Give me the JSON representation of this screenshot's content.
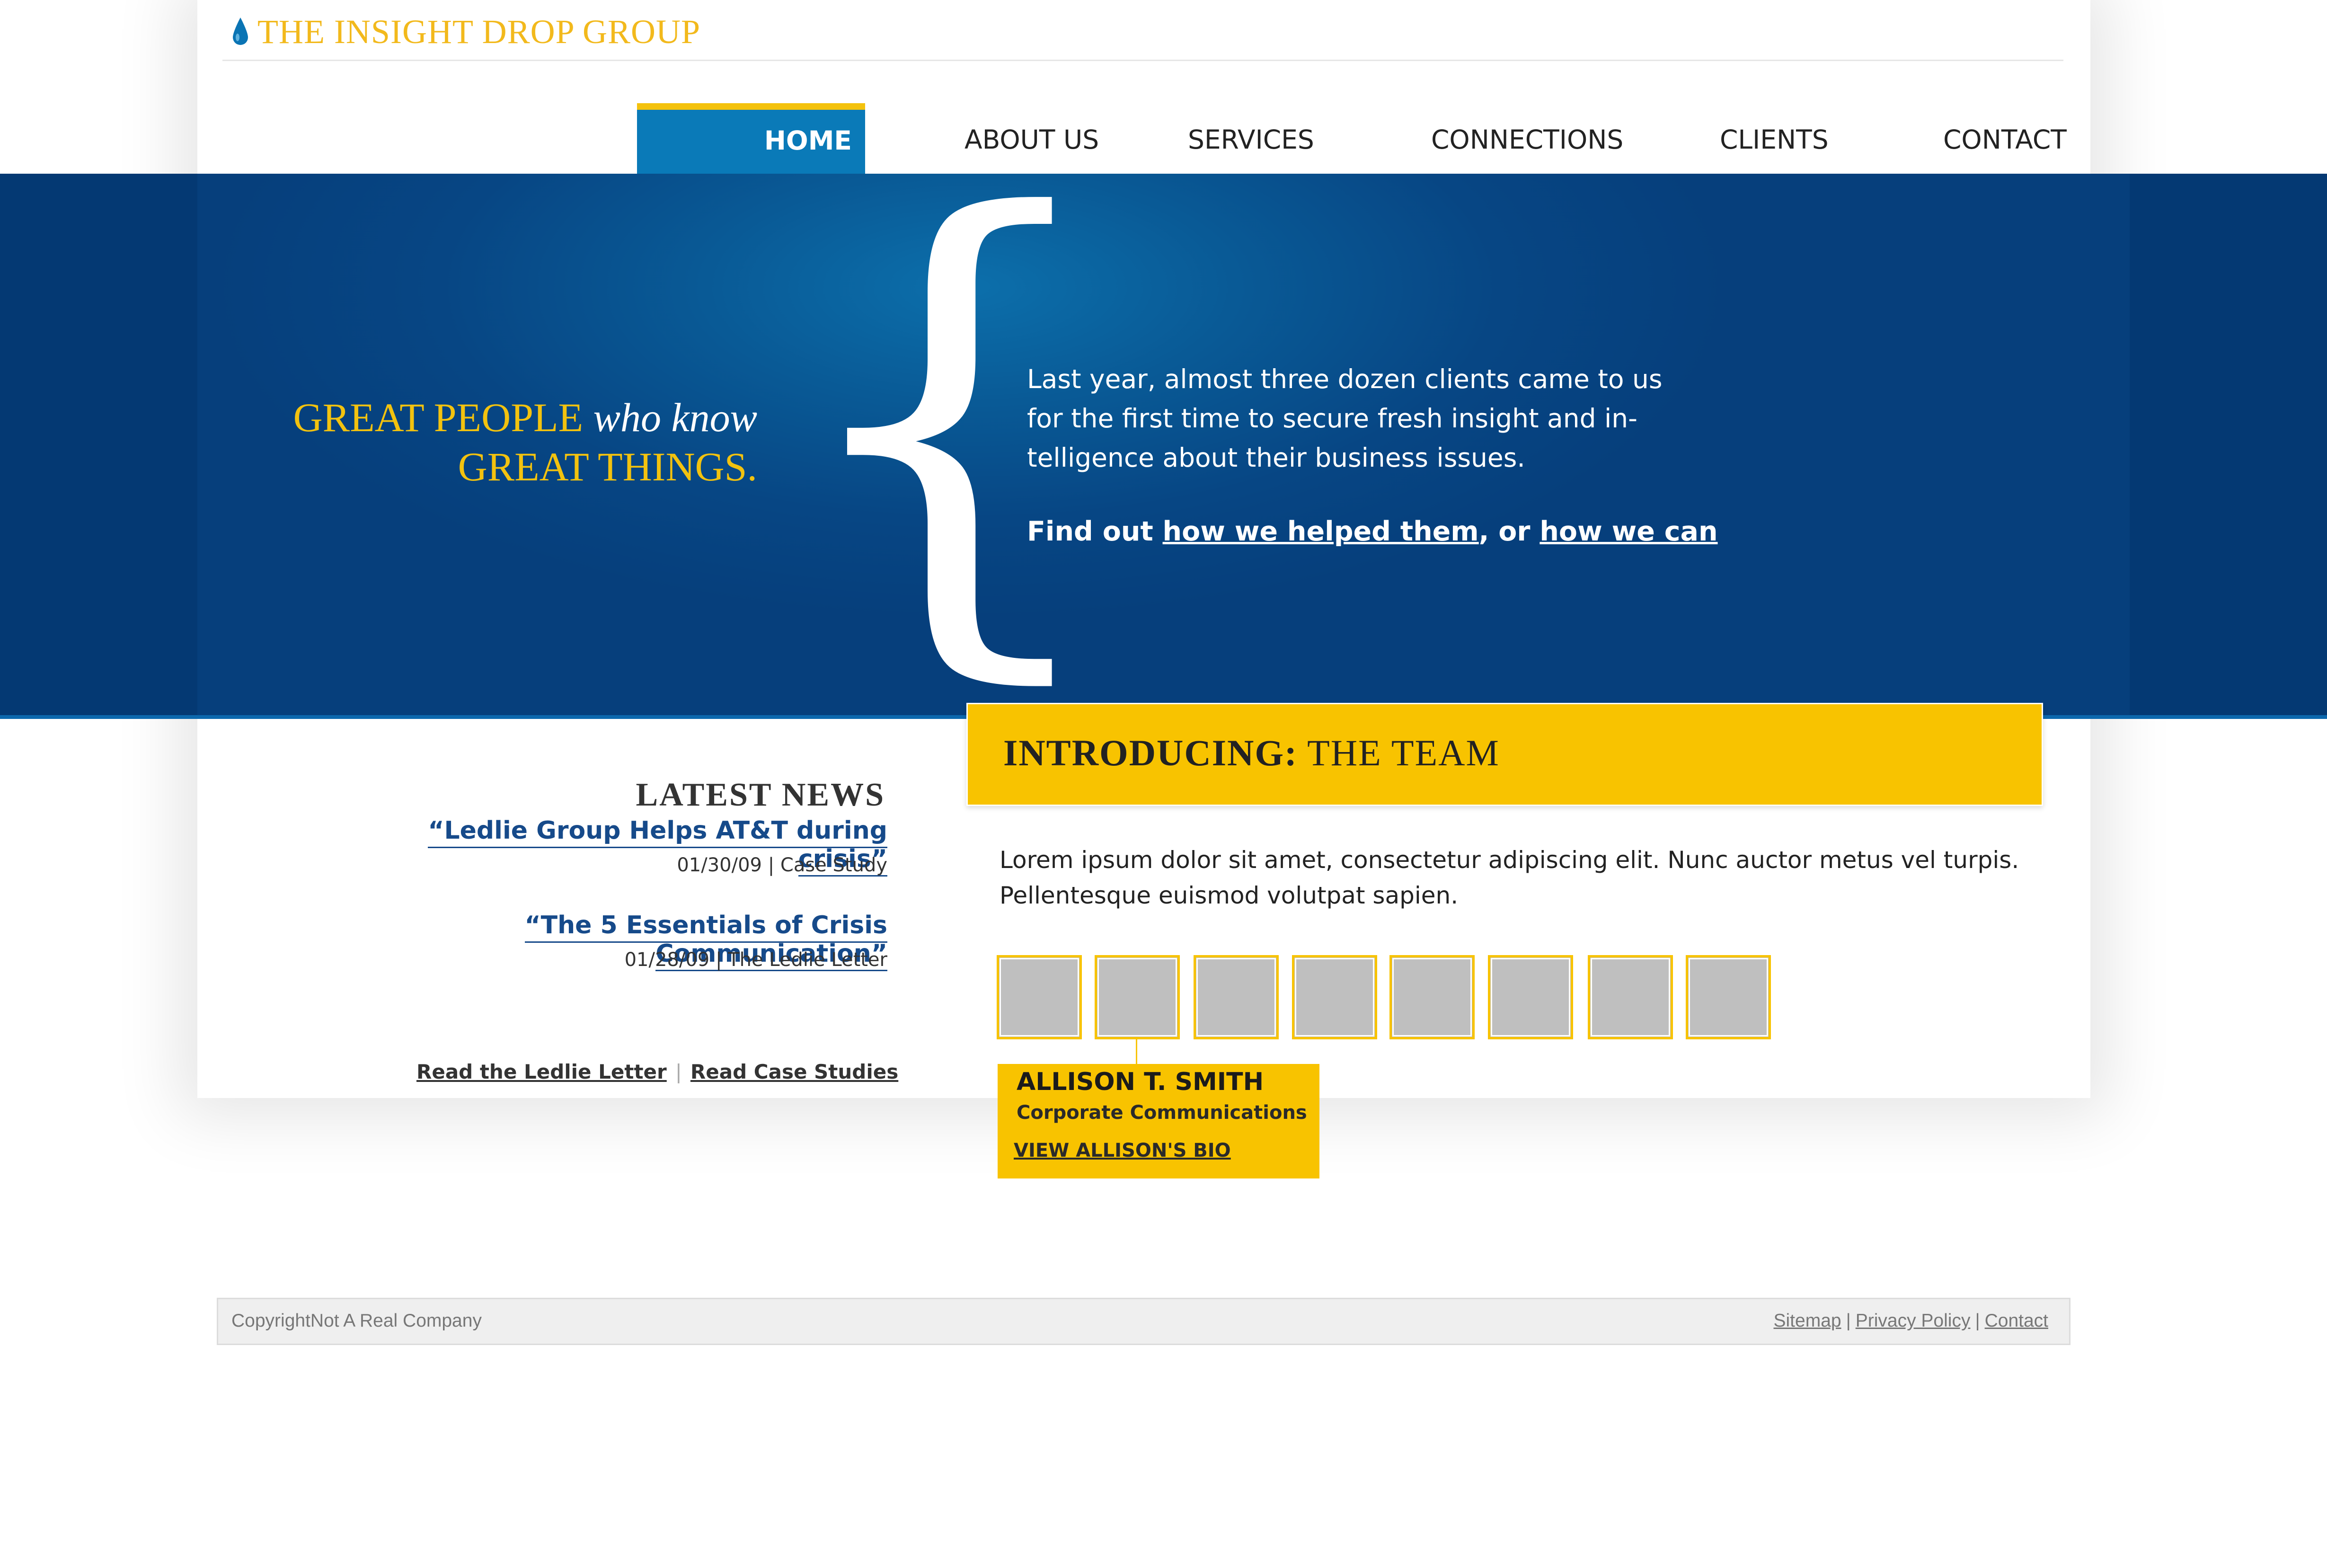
{
  "header": {
    "logo_text": "THE INSIGHT DROP GROUP",
    "logo_icon": "water-drop-icon"
  },
  "nav": {
    "items": [
      {
        "label": "HOME",
        "active": true
      },
      {
        "label": "ABOUT US"
      },
      {
        "label": "SERVICES"
      },
      {
        "label": "CONNECTIONS"
      },
      {
        "label": "CLIENTS"
      },
      {
        "label": "CONTACT"
      }
    ]
  },
  "hero": {
    "brace": "{",
    "tagline_part1": "GREAT PEOPLE ",
    "tagline_part2": "who know",
    "tagline_part3": "GREAT THINGS.",
    "text": "Last year, almost three dozen clients came to us for the first time to secure fresh insight and in-telligence about their business issues.",
    "cta_prefix": "Find out ",
    "cta_link1": "how we helped them",
    "cta_middle": ", or ",
    "cta_link2": "how we can"
  },
  "news": {
    "title": "LATEST NEWS",
    "items": [
      {
        "title": "“Ledlie Group Helps AT&T during crisis”",
        "meta": "01/30/09 | Case Study"
      },
      {
        "title": "“The 5 Essentials of Crisis Communication”",
        "meta": "01/28/09 | The Ledlie Letter"
      }
    ],
    "link1": "Read the Ledlie Letter",
    "separator": "|",
    "link2": "Read Case Studies"
  },
  "team": {
    "intro_bold": "INTRODUCING:",
    "intro_rest": " THE TEAM",
    "description": "Lorem ipsum dolor sit amet, consectetur adipiscing elit. Nunc auctor metus vel turpis. Pellentesque euismod volutpat sapien.",
    "selected": {
      "name": "ALLISON T. SMITH",
      "role": "Corporate Communications",
      "bio_link": "VIEW ALLISON'S BIO"
    }
  },
  "footer": {
    "copyright": "CopyrightNot A Real Company",
    "links": [
      "Sitemap",
      "Privacy Policy",
      "Contact"
    ],
    "separator": "|"
  },
  "colors": {
    "accent_yellow": "#f8c300",
    "hero_blue": "#074684",
    "nav_active_blue": "#0a7ab8",
    "link_blue": "#164a8a"
  }
}
